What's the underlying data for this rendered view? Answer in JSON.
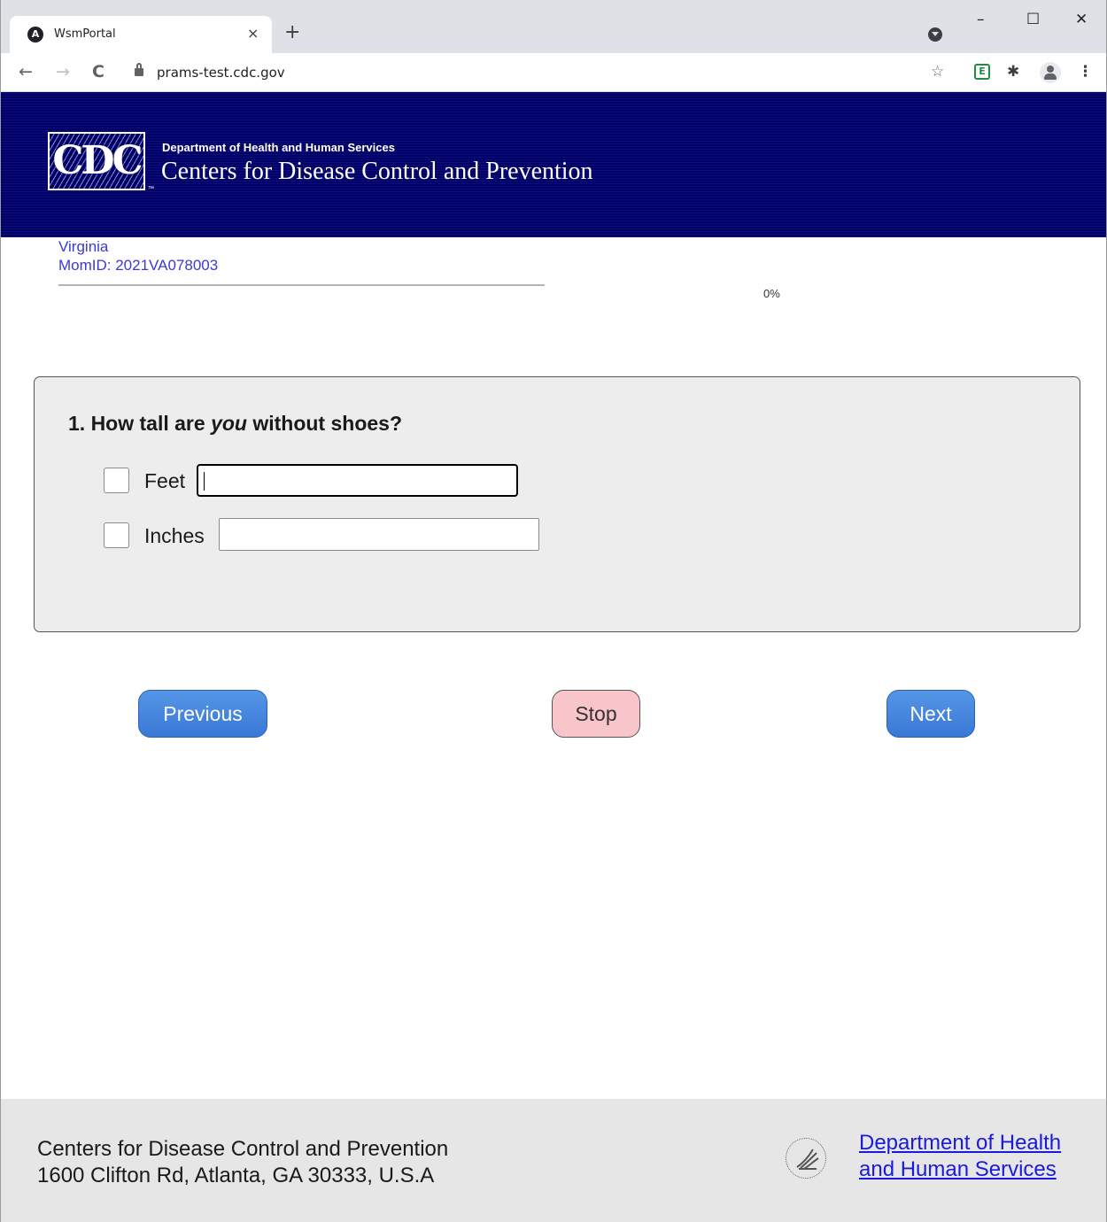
{
  "browser": {
    "tab_title": "WsmPortal",
    "tab_favicon": "A",
    "tab_close": "×",
    "new_tab": "+",
    "url": "prams-test.cdc.gov",
    "nav_back": "←",
    "nav_forward": "→",
    "nav_reload": "C",
    "window_minimize": "–",
    "window_maximize": "☐",
    "window_close": "✕",
    "star_icon": "☆",
    "extension_label": "E",
    "menu_icon": "⋮"
  },
  "header": {
    "logo_text": "CDC",
    "trademark": "™",
    "department": "Department of Health and Human Services",
    "agency": "Centers for Disease Control and Prevention"
  },
  "respondent": {
    "state": "Virginia",
    "mom_id": "MomID: 2021VA078003"
  },
  "progress": {
    "percent": 0,
    "label": "0%"
  },
  "question": {
    "number_prefix": "1. How tall are ",
    "emphasis": "you",
    "suffix": " without shoes?",
    "fields": [
      {
        "label": "Feet",
        "value": "",
        "checked": false,
        "focused": true
      },
      {
        "label": "Inches",
        "value": "",
        "checked": false,
        "focused": false
      }
    ]
  },
  "navigation": {
    "previous_label": "Previous",
    "stop_label": "Stop",
    "next_label": "Next"
  },
  "footer": {
    "org_name": "Centers for Disease Control and Prevention",
    "address": "1600 Clifton Rd, Atlanta, GA 30333, U.S.A",
    "hhs_link_line1": "Department of Health",
    "hhs_link_line2": "and Human Services"
  },
  "colors": {
    "header_bg": "#00006b",
    "info_text": "#3a3ad6",
    "button_blue": "#3a78d6",
    "stop_pink": "#f8c5cb",
    "link": "#1a1adc"
  }
}
